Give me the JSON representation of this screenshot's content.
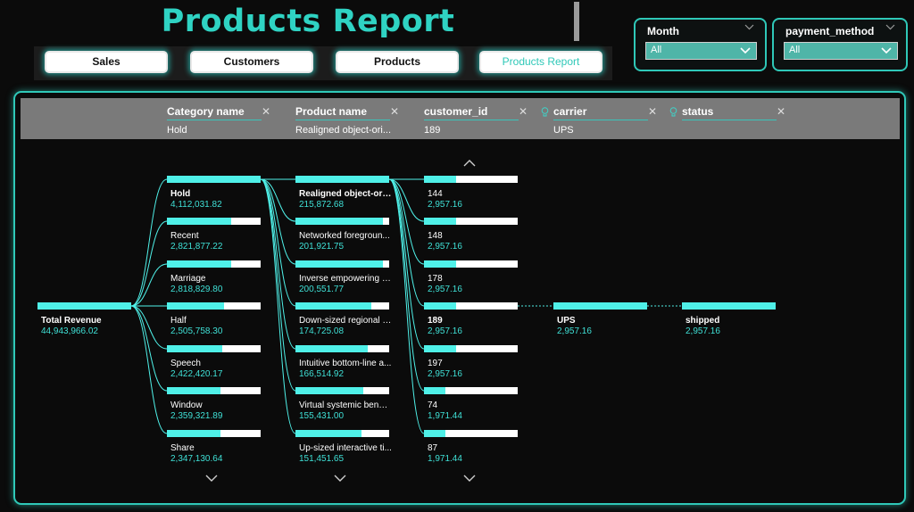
{
  "title": "Products Report",
  "nav": {
    "sales": "Sales",
    "customers": "Customers",
    "products": "Products",
    "products_report": "Products Report"
  },
  "slicers": {
    "month": {
      "label": "Month",
      "value": "All"
    },
    "payment_method": {
      "label": "payment_method",
      "value": "All"
    }
  },
  "tree": {
    "headers": [
      {
        "name": "Category name",
        "value": "Hold"
      },
      {
        "name": "Product name",
        "value": "Realigned object-ori..."
      },
      {
        "name": "customer_id",
        "value": "189"
      },
      {
        "name": "carrier",
        "value": "UPS"
      },
      {
        "name": "status",
        "value": ""
      }
    ],
    "root": {
      "name": "Total Revenue",
      "value": "44,943,966.02"
    },
    "categories": [
      {
        "name": "Hold",
        "value": "4,112,031.82",
        "fill": 1.0
      },
      {
        "name": "Recent",
        "value": "2,821,877.22",
        "fill": 0.69
      },
      {
        "name": "Marriage",
        "value": "2,818,829.80",
        "fill": 0.69
      },
      {
        "name": "Half",
        "value": "2,505,758.30",
        "fill": 0.61
      },
      {
        "name": "Speech",
        "value": "2,422,420.17",
        "fill": 0.59
      },
      {
        "name": "Window",
        "value": "2,359,321.89",
        "fill": 0.57
      },
      {
        "name": "Share",
        "value": "2,347,130.64",
        "fill": 0.57
      }
    ],
    "products": [
      {
        "name": "Realigned object-ori...",
        "value": "215,872.68",
        "fill": 1.0
      },
      {
        "name": "Networked foregroun...",
        "value": "201,921.75",
        "fill": 0.93
      },
      {
        "name": "Inverse empowering n...",
        "value": "200,551.77",
        "fill": 0.93
      },
      {
        "name": "Down-sized regional c...",
        "value": "174,725.08",
        "fill": 0.81
      },
      {
        "name": "Intuitive bottom-line a...",
        "value": "166,514.92",
        "fill": 0.77
      },
      {
        "name": "Virtual systemic bench...",
        "value": "155,431.00",
        "fill": 0.72
      },
      {
        "name": "Up-sized interactive ti...",
        "value": "151,451.65",
        "fill": 0.7
      }
    ],
    "customers": [
      {
        "name": "144",
        "value": "2,957.16",
        "fill": 0.34
      },
      {
        "name": "148",
        "value": "2,957.16",
        "fill": 0.34
      },
      {
        "name": "178",
        "value": "2,957.16",
        "fill": 0.34
      },
      {
        "name": "189",
        "value": "2,957.16",
        "fill": 0.34
      },
      {
        "name": "197",
        "value": "2,957.16",
        "fill": 0.34
      },
      {
        "name": "74",
        "value": "1,971.44",
        "fill": 0.23
      },
      {
        "name": "87",
        "value": "1,971.44",
        "fill": 0.23
      }
    ],
    "carrier": {
      "name": "UPS",
      "value": "2,957.16",
      "fill": 1.0
    },
    "status": {
      "name": "shipped",
      "value": "2,957.16",
      "fill": 1.0
    },
    "selected": {
      "category": 0,
      "product": 0,
      "customer": 3
    }
  },
  "colors": {
    "accent": "#2fd3c3",
    "bar_fill": "#4ff0e8",
    "header_bg": "#7a7a7a"
  }
}
